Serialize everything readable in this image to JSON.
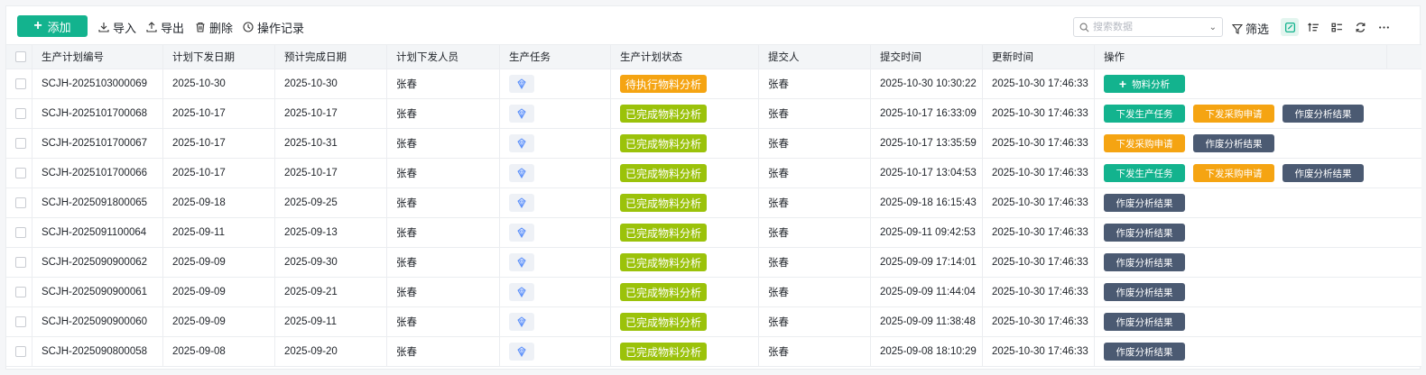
{
  "toolbar": {
    "add_label": "添加",
    "import_label": "导入",
    "export_label": "导出",
    "delete_label": "删除",
    "history_label": "操作记录",
    "search_placeholder": "搜索数据",
    "filter_label": "筛选"
  },
  "colors": {
    "primary": "#13b38e",
    "pending": "#f5a412",
    "done": "#9bc20a",
    "slate": "#4b5a72"
  },
  "table": {
    "columns": [
      "生产计划编号",
      "计划下发日期",
      "预计完成日期",
      "计划下发人员",
      "生产任务",
      "生产计划状态",
      "提交人",
      "提交时间",
      "更新时间",
      "操作"
    ],
    "rows": [
      {
        "code": "SCJH-2025103000069",
        "issue_date": "2025-10-30",
        "due_date": "2025-10-30",
        "issuer": "张春",
        "status": "待执行物料分析",
        "status_type": "pending",
        "submitter": "张春",
        "submit_time": "2025-10-30 10:30:22",
        "update_time": "2025-10-30 17:46:33",
        "actions": [
          {
            "label": "物料分析",
            "type": "teal",
            "plus": true
          }
        ]
      },
      {
        "code": "SCJH-2025101700068",
        "issue_date": "2025-10-17",
        "due_date": "2025-10-17",
        "issuer": "张春",
        "status": "已完成物料分析",
        "status_type": "done",
        "submitter": "张春",
        "submit_time": "2025-10-17 16:33:09",
        "update_time": "2025-10-30 17:46:33",
        "actions": [
          {
            "label": "下发生产任务",
            "type": "teal"
          },
          {
            "label": "下发采购申请",
            "type": "orange"
          },
          {
            "label": "作废分析结果",
            "type": "slate"
          }
        ]
      },
      {
        "code": "SCJH-2025101700067",
        "issue_date": "2025-10-17",
        "due_date": "2025-10-31",
        "issuer": "张春",
        "status": "已完成物料分析",
        "status_type": "done",
        "submitter": "张春",
        "submit_time": "2025-10-17 13:35:59",
        "update_time": "2025-10-30 17:46:33",
        "actions": [
          {
            "label": "下发采购申请",
            "type": "orange"
          },
          {
            "label": "作废分析结果",
            "type": "slate"
          }
        ]
      },
      {
        "code": "SCJH-2025101700066",
        "issue_date": "2025-10-17",
        "due_date": "2025-10-17",
        "issuer": "张春",
        "status": "已完成物料分析",
        "status_type": "done",
        "submitter": "张春",
        "submit_time": "2025-10-17 13:04:53",
        "update_time": "2025-10-30 17:46:33",
        "actions": [
          {
            "label": "下发生产任务",
            "type": "teal"
          },
          {
            "label": "下发采购申请",
            "type": "orange"
          },
          {
            "label": "作废分析结果",
            "type": "slate"
          }
        ]
      },
      {
        "code": "SCJH-2025091800065",
        "issue_date": "2025-09-18",
        "due_date": "2025-09-25",
        "issuer": "张春",
        "status": "已完成物料分析",
        "status_type": "done",
        "submitter": "张春",
        "submit_time": "2025-09-18 16:15:43",
        "update_time": "2025-10-30 17:46:33",
        "actions": [
          {
            "label": "作废分析结果",
            "type": "slate"
          }
        ]
      },
      {
        "code": "SCJH-2025091100064",
        "issue_date": "2025-09-11",
        "due_date": "2025-09-13",
        "issuer": "张春",
        "status": "已完成物料分析",
        "status_type": "done",
        "submitter": "张春",
        "submit_time": "2025-09-11 09:42:53",
        "update_time": "2025-10-30 17:46:33",
        "actions": [
          {
            "label": "作废分析结果",
            "type": "slate"
          }
        ]
      },
      {
        "code": "SCJH-2025090900062",
        "issue_date": "2025-09-09",
        "due_date": "2025-09-30",
        "issuer": "张春",
        "status": "已完成物料分析",
        "status_type": "done",
        "submitter": "张春",
        "submit_time": "2025-09-09 17:14:01",
        "update_time": "2025-10-30 17:46:33",
        "actions": [
          {
            "label": "作废分析结果",
            "type": "slate"
          }
        ]
      },
      {
        "code": "SCJH-2025090900061",
        "issue_date": "2025-09-09",
        "due_date": "2025-09-21",
        "issuer": "张春",
        "status": "已完成物料分析",
        "status_type": "done",
        "submitter": "张春",
        "submit_time": "2025-09-09 11:44:04",
        "update_time": "2025-10-30 17:46:33",
        "actions": [
          {
            "label": "作废分析结果",
            "type": "slate"
          }
        ]
      },
      {
        "code": "SCJH-2025090900060",
        "issue_date": "2025-09-09",
        "due_date": "2025-09-11",
        "issuer": "张春",
        "status": "已完成物料分析",
        "status_type": "done",
        "submitter": "张春",
        "submit_time": "2025-09-09 11:38:48",
        "update_time": "2025-10-30 17:46:33",
        "actions": [
          {
            "label": "作废分析结果",
            "type": "slate"
          }
        ]
      },
      {
        "code": "SCJH-2025090800058",
        "issue_date": "2025-09-08",
        "due_date": "2025-09-20",
        "issuer": "张春",
        "status": "已完成物料分析",
        "status_type": "done",
        "submitter": "张春",
        "submit_time": "2025-09-08 18:10:29",
        "update_time": "2025-10-30 17:46:33",
        "actions": [
          {
            "label": "作废分析结果",
            "type": "slate"
          }
        ]
      }
    ]
  }
}
